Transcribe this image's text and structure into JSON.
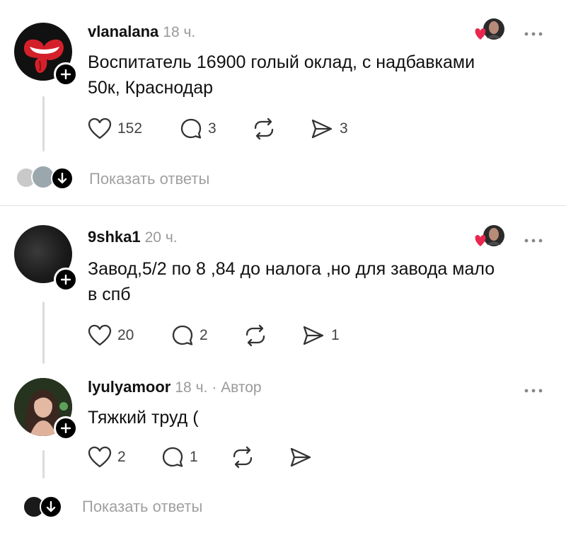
{
  "posts": [
    {
      "username": "vlanalana",
      "time": "18 ч.",
      "text_lines": [
        "Воспитатель 16900 голый оклад, с надбавками",
        "50к, Краснодар"
      ],
      "likes": "152",
      "comments": "3",
      "reposts": "",
      "shares": "3",
      "show_replies": "Показать ответы"
    },
    {
      "username": "9shka1",
      "time": "20 ч.",
      "text_lines": [
        "Завод,5/2 по 8 ,84 до налога ,но для завода мало",
        "в спб"
      ],
      "likes": "20",
      "comments": "2",
      "reposts": "",
      "shares": "1"
    },
    {
      "username": "lyulyamoor",
      "time": "18 ч.",
      "badge": "· Автор",
      "text_lines": [
        "Тяжкий труд ("
      ],
      "likes": "2",
      "comments": "1",
      "reposts": "",
      "shares": "",
      "show_replies": "Показать ответы"
    }
  ],
  "icons": {
    "like": "heart-icon",
    "comment": "comment-icon",
    "repost": "repost-icon",
    "share": "share-icon",
    "more": "more-icon",
    "follow": "plus-icon",
    "liked_by_author": "liked-by-author-icon"
  },
  "colors": {
    "heart_red": "#e8274f",
    "meta_gray": "#9a9a9a"
  }
}
